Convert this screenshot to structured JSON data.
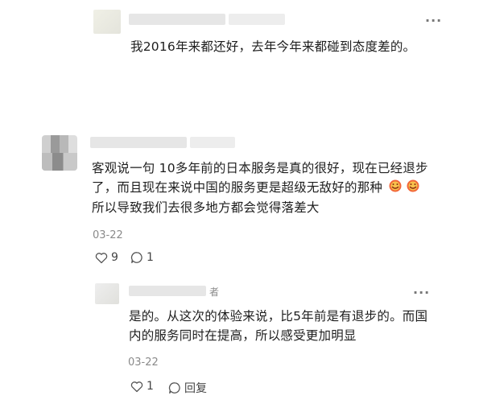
{
  "comment1": {
    "text": "我2016年来都还好，去年今年来都碰到态度差的。",
    "more": "···"
  },
  "comment2": {
    "text": "客观说一句 10多年前的日本服务是真的很好，现在已经退步了，而且现在来说中国的服务更是超级无敌好的那种",
    "text_after_emoji": "所以导致我们去很多地方都会觉得落差大",
    "date": "03-22",
    "likes": "9",
    "replies": "1",
    "more": "···"
  },
  "reply1": {
    "name_suffix": "者",
    "text": "是的。从这次的体验来说，比5年前是有退步的。而国内的服务同时在提高，所以感受更加明显",
    "date": "03-22",
    "likes": "1",
    "reply_label": "回复",
    "more": "···"
  },
  "icons": {
    "like": "heart-icon",
    "comment": "comment-bubble-icon",
    "emoji": "laughing-emoji-icon"
  }
}
